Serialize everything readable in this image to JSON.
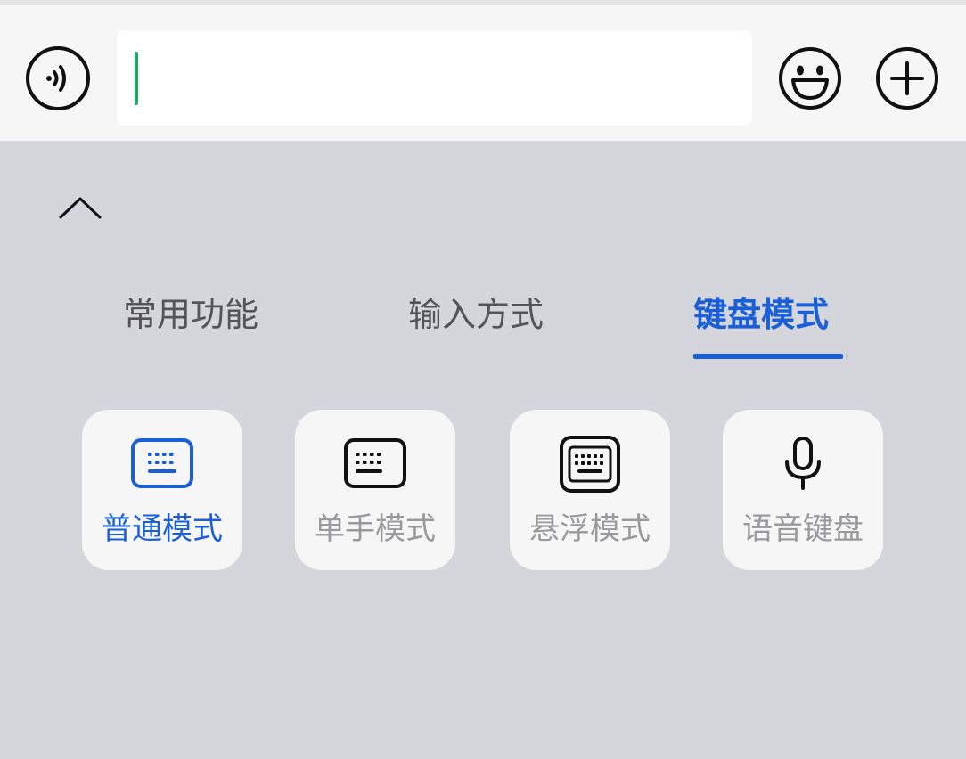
{
  "input_bar": {
    "text_value": "",
    "left_button_icon": "voice-input-icon",
    "emoji_button_icon": "emoji-icon",
    "plus_button_icon": "plus-icon"
  },
  "panel": {
    "collapse_icon": "chevron-up-icon",
    "tabs": [
      {
        "label": "常用功能",
        "active": false
      },
      {
        "label": "输入方式",
        "active": false
      },
      {
        "label": "键盘模式",
        "active": true
      }
    ],
    "modes": [
      {
        "label": "普通模式",
        "icon": "keyboard-icon",
        "selected": true
      },
      {
        "label": "单手模式",
        "icon": "keyboard-one-hand-icon",
        "selected": false
      },
      {
        "label": "悬浮模式",
        "icon": "keyboard-floating-icon",
        "selected": false
      },
      {
        "label": "语音键盘",
        "icon": "microphone-icon",
        "selected": false
      }
    ]
  },
  "colors": {
    "accent": "#1a5fd8",
    "caret": "#1aad5e",
    "panel_background": "#d5d6dc",
    "card_background": "#f6f6f7",
    "inactive_tab": "#555557",
    "inactive_label": "#9a9a9c"
  }
}
